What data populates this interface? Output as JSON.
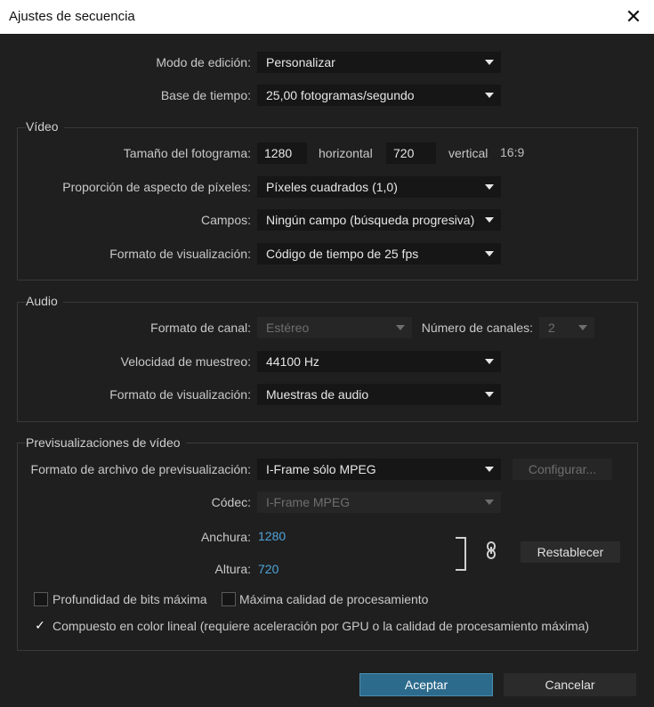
{
  "window": {
    "title": "Ajustes de secuencia",
    "close_glyph": "✕"
  },
  "general": {
    "edit_mode_label": "Modo de edición:",
    "edit_mode_value": "Personalizar",
    "timebase_label": "Base de tiempo:",
    "timebase_value": "25,00 fotogramas/segundo"
  },
  "video": {
    "title": "Vídeo",
    "frame_size_label": "Tamaño del fotograma:",
    "width": "1280",
    "horizontal_label": "horizontal",
    "height": "720",
    "vertical_label": "vertical",
    "aspect": "16:9",
    "pixel_aspect_label": "Proporción de aspecto de píxeles:",
    "pixel_aspect_value": "Píxeles cuadrados (1,0)",
    "fields_label": "Campos:",
    "fields_value": "Ningún campo (búsqueda progresiva)",
    "display_format_label": "Formato de visualización:",
    "display_format_value": "Código de tiempo de 25 fps"
  },
  "audio": {
    "title": "Audio",
    "channel_format_label": "Formato de canal:",
    "channel_format_value": "Estéreo",
    "channels_count_label": "Número de canales:",
    "channels_count_value": "2",
    "sample_rate_label": "Velocidad de muestreo:",
    "sample_rate_value": "44100 Hz",
    "display_format_label": "Formato de visualización:",
    "display_format_value": "Muestras de audio"
  },
  "previews": {
    "title": "Previsualizaciones de vídeo",
    "file_format_label": "Formato de archivo de previsualización:",
    "file_format_value": "I-Frame sólo MPEG",
    "configure_label": "Configurar...",
    "codec_label": "Códec:",
    "codec_value": "I-Frame MPEG",
    "width_label": "Anchura:",
    "width_value": "1280",
    "height_label": "Altura:",
    "height_value": "720",
    "link_icon": "link-icon",
    "reset_label": "Restablecer",
    "max_bit_depth_label": "Profundidad de bits máxima",
    "max_bit_depth_checked": false,
    "max_render_quality_label": "Máxima calidad de procesamiento",
    "max_render_quality_checked": false,
    "linear_color_label": "Compuesto en color lineal (requiere aceleración por GPU o la calidad de procesamiento máxima)",
    "linear_color_checked": true
  },
  "footer": {
    "ok_label": "Aceptar",
    "cancel_label": "Cancelar"
  },
  "colors": {
    "accent": "#2d6b8c",
    "link_value": "#4fa3d9",
    "background": "#1f1f1f"
  }
}
